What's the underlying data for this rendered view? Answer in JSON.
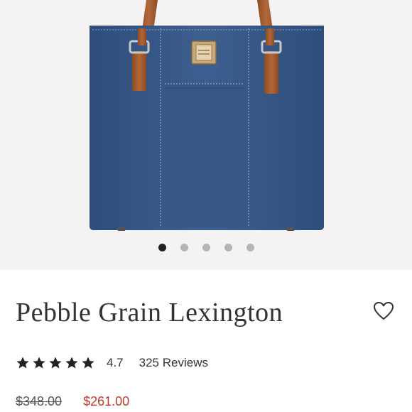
{
  "product": {
    "name": "Pebble Grain Lexington",
    "rating": "4.7",
    "reviews_label": "325 Reviews",
    "star_count": 5,
    "original_price": "$348.00",
    "sale_price": "$261.00"
  },
  "gallery": {
    "image_count": 5,
    "active_index": 0
  },
  "colors": {
    "bag": "#3a5a88",
    "strap": "#a65a2c",
    "sale_price": "#c0392b"
  },
  "icons": {
    "favorite": "heart-outline-icon",
    "rating": "star-icon"
  }
}
